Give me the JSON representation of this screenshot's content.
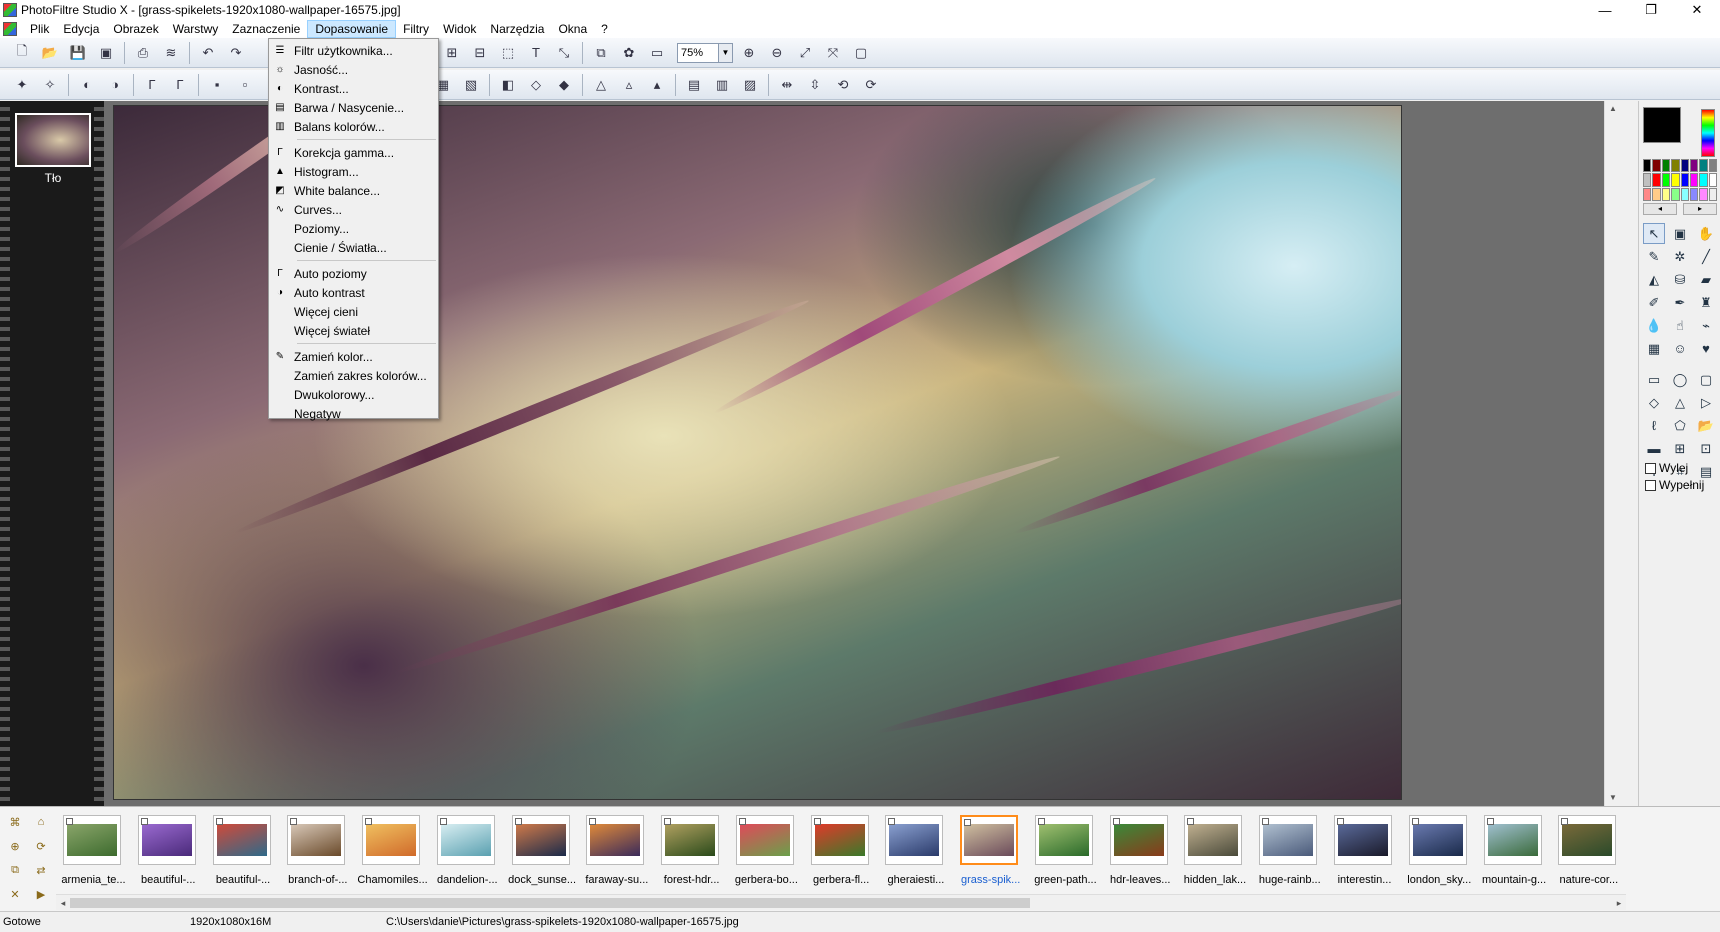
{
  "window": {
    "title": "PhotoFiltre Studio X - [grass-spikelets-1920x1080-wallpaper-16575.jpg]",
    "controls": [
      "—",
      "❐",
      "✕"
    ]
  },
  "menubar": {
    "items": [
      "Plik",
      "Edycja",
      "Obrazek",
      "Warstwy",
      "Zaznaczenie",
      "Dopasowanie",
      "Filtry",
      "Widok",
      "Narzędzia",
      "Okna",
      "?"
    ],
    "active": "Dopasowanie",
    "mdi_controls": [
      "_",
      "❐",
      "✕"
    ]
  },
  "toolbar": {
    "zoom": "75%"
  },
  "adjust_menu": {
    "items": [
      {
        "label": "Filtr użytkownika...",
        "icon": "user-filter-icon"
      },
      {
        "label": "Jasność...",
        "icon": "brightness-icon"
      },
      {
        "label": "Kontrast...",
        "icon": "contrast-icon"
      },
      {
        "label": "Barwa / Nasycenie...",
        "icon": "hue-saturation-icon"
      },
      {
        "label": "Balans kolorów...",
        "icon": "color-balance-icon"
      },
      {
        "sep": true
      },
      {
        "label": "Korekcja gamma...",
        "icon": "gamma-icon"
      },
      {
        "label": "Histogram...",
        "icon": "histogram-icon"
      },
      {
        "label": "White balance...",
        "icon": "white-balance-icon"
      },
      {
        "label": "Curves...",
        "icon": "curves-icon"
      },
      {
        "label": "Poziomy...",
        "icon": ""
      },
      {
        "label": "Cienie / Światła...",
        "icon": ""
      },
      {
        "sep": true
      },
      {
        "label": "Auto poziomy",
        "icon": "auto-levels-icon"
      },
      {
        "label": "Auto kontrast",
        "icon": "auto-contrast-icon"
      },
      {
        "label": "Więcej cieni",
        "icon": ""
      },
      {
        "label": "Więcej świateł",
        "icon": ""
      },
      {
        "sep": true
      },
      {
        "label": "Zamień kolor...",
        "icon": "replace-color-icon"
      },
      {
        "label": "Zamień zakres kolorów...",
        "icon": ""
      },
      {
        "label": "Dwukolorowy...",
        "icon": ""
      },
      {
        "label": "Negatyw",
        "icon": ""
      }
    ]
  },
  "layers": {
    "items": [
      {
        "label": "Tło"
      }
    ]
  },
  "right_panel": {
    "outline_label": "Wylej",
    "fill_label": "Wypełnij"
  },
  "browser": {
    "thumbs": [
      {
        "label": "armenia_te...",
        "c1": "#3d6b2e",
        "c2": "#8aa56a"
      },
      {
        "label": "beautiful-...",
        "c1": "#4a2a7a",
        "c2": "#9a6ad0"
      },
      {
        "label": "beautiful-...",
        "c1": "#2e6a8a",
        "c2": "#d04a3a"
      },
      {
        "label": "branch-of-...",
        "c1": "#6a4a2a",
        "c2": "#d8c8b8"
      },
      {
        "label": "Chamomiles...",
        "c1": "#d06a2a",
        "c2": "#f0c060"
      },
      {
        "label": "dandelion-...",
        "c1": "#5aa0b0",
        "c2": "#d8eef2"
      },
      {
        "label": "dock_sunse...",
        "c1": "#1a2a4a",
        "c2": "#d07a4a"
      },
      {
        "label": "faraway-su...",
        "c1": "#3a2a5a",
        "c2": "#e08a3a"
      },
      {
        "label": "forest-hdr...",
        "c1": "#2a4a1a",
        "c2": "#b0a060"
      },
      {
        "label": "gerbera-bo...",
        "c1": "#6aa04a",
        "c2": "#e04a5a"
      },
      {
        "label": "gerbera-fl...",
        "c1": "#3a7a2a",
        "c2": "#e03a2a"
      },
      {
        "label": "gheraiesti...",
        "c1": "#2a3a6a",
        "c2": "#8aa0d0"
      },
      {
        "label": "grass-spik...",
        "c1": "#6a4a5a",
        "c2": "#d0c0a0"
      },
      {
        "label": "green-path...",
        "c1": "#2a6a2a",
        "c2": "#a0c070"
      },
      {
        "label": "hdr-leaves...",
        "c1": "#8a3a1a",
        "c2": "#3a8a3a"
      },
      {
        "label": "hidden_lak...",
        "c1": "#4a4a3a",
        "c2": "#c0b090"
      },
      {
        "label": "huge-rainb...",
        "c1": "#4a5a7a",
        "c2": "#b0c0d0"
      },
      {
        "label": "interestin...",
        "c1": "#1a1a2a",
        "c2": "#5a6a9a"
      },
      {
        "label": "london_sky...",
        "c1": "#1a2a4a",
        "c2": "#6a7ab0"
      },
      {
        "label": "mountain-g...",
        "c1": "#3a6a3a",
        "c2": "#a0c0d0"
      },
      {
        "label": "nature-cor...",
        "c1": "#2a4a2a",
        "c2": "#7a6a3a"
      }
    ],
    "selected_index": 12
  },
  "statusbar": {
    "state": "Gotowe",
    "dimensions": "1920x1080x16M",
    "path": "C:\\Users\\danie\\Pictures\\grass-spikelets-1920x1080-wallpaper-16575.jpg"
  },
  "colors": {
    "accent": "#cce8ff",
    "selection_border": "#ff8c1a",
    "selected_caption": "#1a5fd0"
  }
}
